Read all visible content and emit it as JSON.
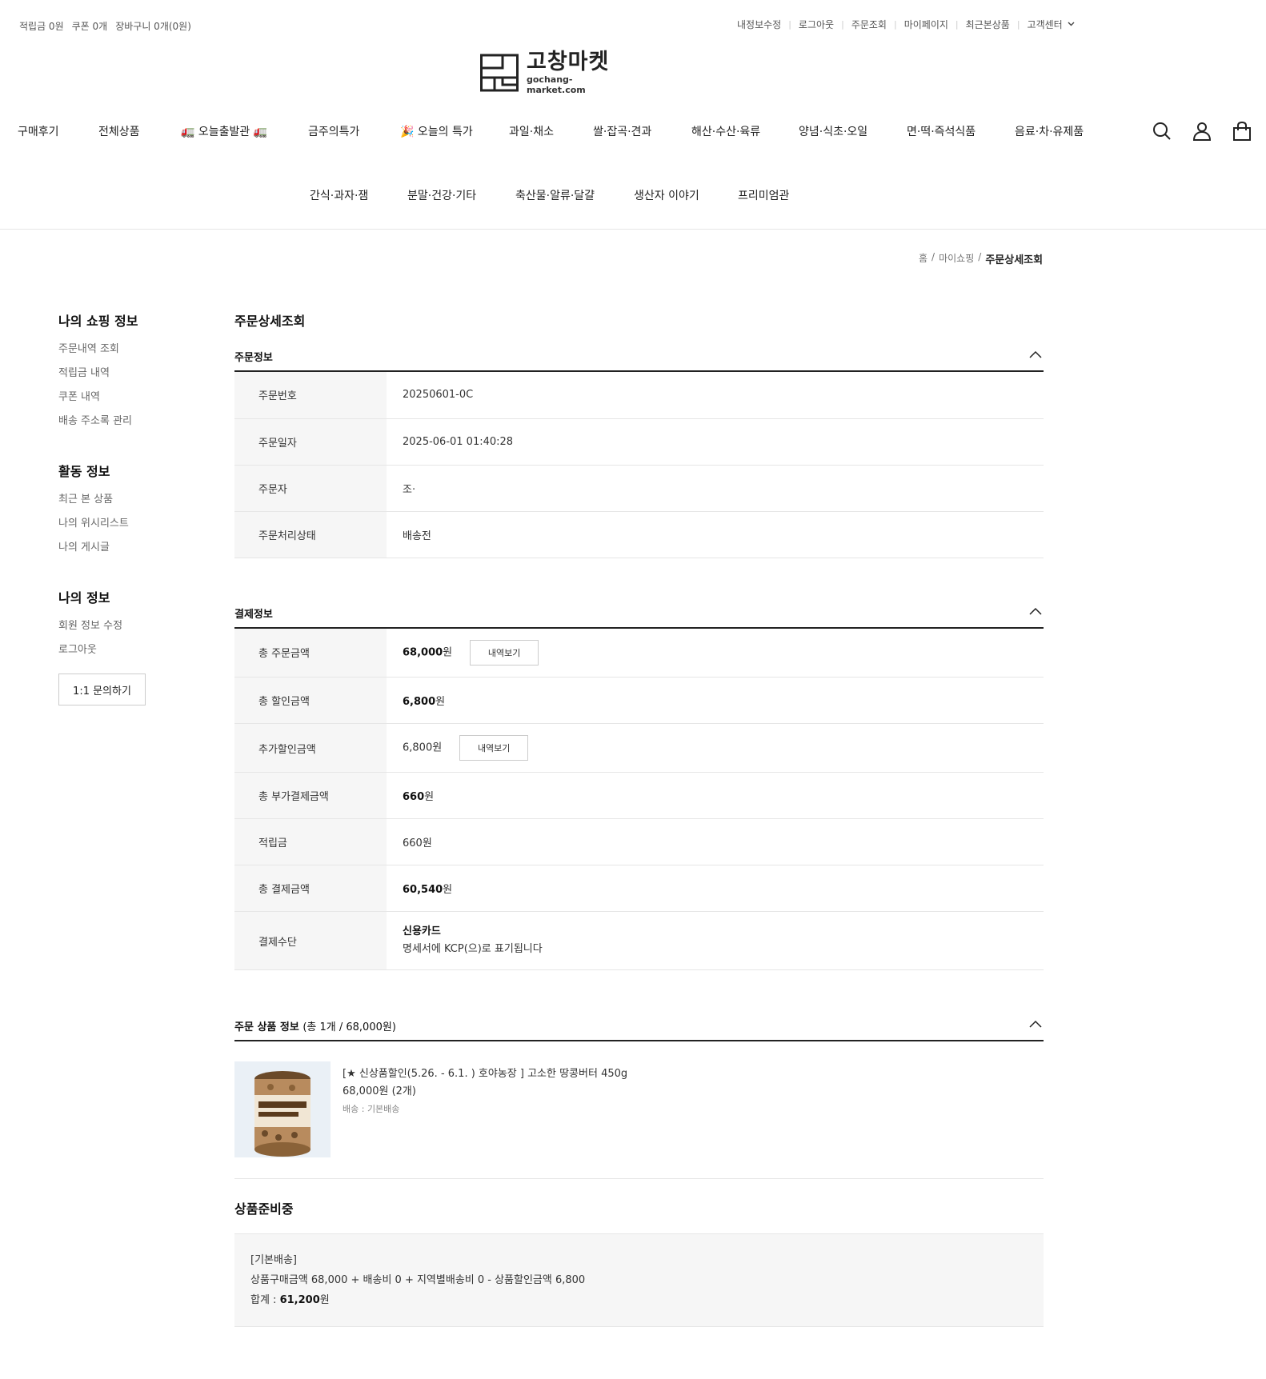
{
  "topbar": {
    "left": [
      "적립금 0원",
      "쿠폰 0개",
      "장바구니 0개(0원)"
    ],
    "right": [
      "내정보수정",
      "로그아웃",
      "주문조회",
      "마이페이지",
      "최근본상품",
      "고객센터"
    ]
  },
  "logo": {
    "kr": "고창마켓",
    "en": "gochang-market.com"
  },
  "nav": {
    "row1": [
      "구매후기",
      "전체상품",
      "🚛 오늘출발관 🚛",
      "금주의특가",
      "🎉 오늘의 특가",
      "과일·채소",
      "쌀·잡곡·견과",
      "해산·수산·육류",
      "양념·식초·오일",
      "면·떡·즉석식품",
      "음료·차·유제품"
    ],
    "row2": [
      "간식·과자·잼",
      "분말·건강·기타",
      "축산물·알류·달걀",
      "생산자 이야기",
      "프리미엄관"
    ]
  },
  "breadcrumb": {
    "home": "홈",
    "mid": "마이쇼핑",
    "current": "주문상세조회"
  },
  "side": {
    "shopping_title": "나의 쇼핑 정보",
    "shopping_links": [
      "주문내역 조회",
      "적립금 내역",
      "쿠폰 내역",
      "배송 주소록 관리"
    ],
    "activity_title": "활동 정보",
    "activity_links": [
      "최근 본 상품",
      "나의 위시리스트",
      "나의 게시글"
    ],
    "my_title": "나의 정보",
    "my_links": [
      "회원 정보 수정",
      "로그아웃"
    ],
    "inquiry_button": "1:1 문의하기"
  },
  "main": {
    "title": "주문상세조회",
    "order_info": {
      "title": "주문정보",
      "rows": [
        {
          "label": "주문번호",
          "value": "20250601-0C"
        },
        {
          "label": "주문일자",
          "value": "2025-06-01 01:40:28"
        },
        {
          "label": "주문자",
          "value": "조·"
        },
        {
          "label": "주문처리상태",
          "value": "배송전"
        }
      ]
    },
    "payment": {
      "title": "결제정보",
      "total_order": {
        "label": "총 주문금액",
        "amount": "68,000",
        "unit": "원",
        "button": "내역보기"
      },
      "total_discount": {
        "label": "총 할인금액",
        "amount": "6,800",
        "unit": "원"
      },
      "extra_discount": {
        "label": "추가할인금액",
        "amount": "6,800",
        "unit": "원",
        "button": "내역보기"
      },
      "extra_pay": {
        "label": "총 부가결제금액",
        "amount": "660",
        "unit": "원"
      },
      "points": {
        "label": "적립금",
        "amount": "660",
        "unit": "원"
      },
      "total_pay": {
        "label": "총 결제금액",
        "amount": "60,540",
        "unit": "원"
      },
      "method": {
        "label": "결제수단",
        "name": "신용카드",
        "note": "명세서에 KCP(으)로 표기됩니다"
      }
    },
    "products": {
      "title": "주문 상품 정보",
      "subtitle": "(총 1개 / 68,000원)",
      "items": [
        {
          "name": "[★ 신상품할인(5.26. - 6.1. ) 호야농장 ] 고소한 땅콩버터 450g",
          "price": "68,000원 (2개)",
          "shipping": "배송 : 기본배송"
        }
      ]
    },
    "status_title": "상품준비중",
    "summary": {
      "type": "[기본배송]",
      "formula": "상품구매금액 68,000 + 배송비 0 + 지역별배송비 0 - 상품할인금액 6,800",
      "total_label": "합계 : ",
      "total_amount": "61,200",
      "total_unit": "원"
    }
  },
  "colors": {
    "text": "#222222",
    "muted": "#777777",
    "table_header_bg": "#f6f6f6",
    "border": "#e6e6e6"
  }
}
